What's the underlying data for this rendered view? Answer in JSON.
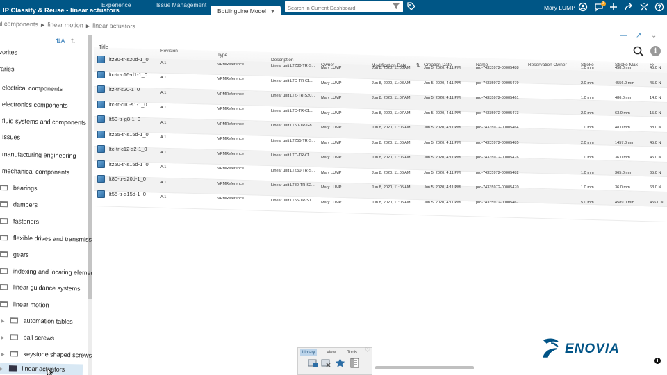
{
  "header": {
    "app_title": "IP Classify & Reuse - linear actuators",
    "tabs": [
      {
        "label": "Experience"
      },
      {
        "label": "Issue Management"
      },
      {
        "label": "BottlingLine Model"
      }
    ],
    "add_tab_label": "+",
    "search_placeholder": "Search in Current Dashboard",
    "user_name": "Mary LUMP",
    "notification_count": "3"
  },
  "breadcrumb": [
    "mechanical components",
    "linear motion",
    "linear actuators"
  ],
  "sidebar": {
    "items": [
      {
        "label": "Favorites"
      },
      {
        "label": "Libraries"
      },
      {
        "label": "electrical components"
      },
      {
        "label": "electronics components"
      },
      {
        "label": "fluid systems and components"
      },
      {
        "label": "Issues"
      },
      {
        "label": "manufacturing engineering"
      },
      {
        "label": "mechanical components"
      },
      {
        "label": "bearings"
      },
      {
        "label": "dampers"
      },
      {
        "label": "fasteners"
      },
      {
        "label": "flexible drives and transmissions"
      },
      {
        "label": "gears"
      },
      {
        "label": "indexing and locating elements"
      },
      {
        "label": "linear guidance systems"
      },
      {
        "label": "linear motion"
      },
      {
        "label": "automation tables"
      },
      {
        "label": "ball screws"
      },
      {
        "label": "keystone shaped screws"
      },
      {
        "label": "linear actuators"
      }
    ]
  },
  "table": {
    "columns": [
      "Title",
      "Revision",
      "Type",
      "Description",
      "Owner",
      "Modification Date",
      "Creation Date",
      "Name",
      "Reservation Owner",
      "Stroke",
      "Stroke Max",
      "Fx"
    ],
    "rows": [
      {
        "title": "ltz80-tr-s20d-1_0",
        "revision": "A.1",
        "type": "VPMReference",
        "description": "Linear unit LTZ80-TR-S...",
        "owner": "Mary LUMP",
        "modified": "Jun 8, 2020, 11:08 AM",
        "created": "Jun 5, 2020, 4:11 PM",
        "name": "prd-74335972-00005488",
        "reservation": "",
        "stroke": "1.0 mm",
        "stroke_max": "458.0 mm",
        "fx": "45.0 N"
      },
      {
        "title": "ltc-tr-c16-d1-1_0",
        "revision": "A.1",
        "type": "VPMReference",
        "description": "Linear unit LTC-TR-C1...",
        "owner": "Mary LUMP",
        "modified": "Jun 8, 2020, 11:08 AM",
        "created": "Jun 5, 2020, 4:11 PM",
        "name": "prd-74335972-00005479",
        "reservation": "",
        "stroke": "2.0 mm",
        "stroke_max": "4556.0 mm",
        "fx": "45.0 N"
      },
      {
        "title": "ltz-tr-s20-1_0",
        "revision": "A.1",
        "type": "VPMReference",
        "description": "Linear unit LTZ-TR-S20...",
        "owner": "Mary LUMP",
        "modified": "Jun 8, 2020, 11:07 AM",
        "created": "Jun 5, 2020, 4:11 PM",
        "name": "prd-74335972-00005461",
        "reservation": "",
        "stroke": "1.0 mm",
        "stroke_max": "486.0 mm",
        "fx": "14.0 N"
      },
      {
        "title": "ltc-tr-c10-s1-1_0",
        "revision": "A.1",
        "type": "VPMReference",
        "description": "Linear unit LTC-TR-C1...",
        "owner": "Mary LUMP",
        "modified": "Jun 8, 2020, 11:07 AM",
        "created": "Jun 5, 2020, 4:11 PM",
        "name": "prd-74335972-00005473",
        "reservation": "",
        "stroke": "2.0 mm",
        "stroke_max": "63.0 mm",
        "fx": "15.0 N"
      },
      {
        "title": "lt50-tr-g8-1_0",
        "revision": "A.1",
        "type": "VPMReference",
        "description": "Linear unit LT50-TR-G8...",
        "owner": "Mary LUMP",
        "modified": "Jun 8, 2020, 11:06 AM",
        "created": "Jun 5, 2020, 4:11 PM",
        "name": "prd-74335972-00005464",
        "reservation": "",
        "stroke": "1.0 mm",
        "stroke_max": "48.0 mm",
        "fx": "88.0 N"
      },
      {
        "title": "ltz55-tr-s15d-1_0",
        "revision": "A.1",
        "type": "VPMReference",
        "description": "Linear unit LTZ55-TR-S...",
        "owner": "Mary LUMP",
        "modified": "Jun 8, 2020, 11:06 AM",
        "created": "Jun 5, 2020, 4:11 PM",
        "name": "prd-74335972-00005485",
        "reservation": "",
        "stroke": "2.0 mm",
        "stroke_max": "1457.0 mm",
        "fx": "45.0 N"
      },
      {
        "title": "ltc-tr-c12-s2-1_0",
        "revision": "A.1",
        "type": "VPMReference",
        "description": "Linear unit LTC-TR-C1...",
        "owner": "Mary LUMP",
        "modified": "Jun 8, 2020, 11:06 AM",
        "created": "Jun 5, 2020, 4:11 PM",
        "name": "prd-74335972-00005476",
        "reservation": "",
        "stroke": "1.0 mm",
        "stroke_max": "36.0 mm",
        "fx": "45.0 N"
      },
      {
        "title": "ltz50-tr-s15d-1_0",
        "revision": "A.1",
        "type": "VPMReference",
        "description": "Linear unit LTZ50-TR-S...",
        "owner": "Mary LUMP",
        "modified": "Jun 8, 2020, 11:06 AM",
        "created": "Jun 5, 2020, 4:11 PM",
        "name": "prd-74335972-00005482",
        "reservation": "",
        "stroke": "1.0 mm",
        "stroke_max": "365.0 mm",
        "fx": "65.0 N"
      },
      {
        "title": "lt80-tr-s20d-1_0",
        "revision": "A.1",
        "type": "VPMReference",
        "description": "Linear unit LT80-TR-S2...",
        "owner": "Mary LUMP",
        "modified": "Jun 8, 2020, 11:05 AM",
        "created": "Jun 5, 2020, 4:11 PM",
        "name": "prd-74335972-00005470",
        "reservation": "",
        "stroke": "1.0 mm",
        "stroke_max": "36.0 mm",
        "fx": "63.0 N"
      },
      {
        "title": "lt55-tr-s15d-1_0",
        "revision": "A.1",
        "type": "VPMReference",
        "description": "Linear unit LT55-TR-S1...",
        "owner": "Mary LUMP",
        "modified": "Jun 8, 2020, 11:05 AM",
        "created": "Jun 5, 2020, 4:11 PM",
        "name": "prd-74335972-00005467",
        "reservation": "",
        "stroke": "5.0 mm",
        "stroke_max": "4589.0 mm",
        "fx": "456.0 N"
      }
    ]
  },
  "bottom_toolbar": {
    "tabs": [
      {
        "label": "Library"
      },
      {
        "label": "View"
      },
      {
        "label": "Tools"
      }
    ]
  },
  "brand": {
    "name": "ENOVIA",
    "color": "#005386"
  },
  "colors": {
    "topbar": "#005686",
    "accent": "#1f6fb2",
    "selected_row": "#d8e8f4"
  },
  "icons": [
    "search-icon",
    "funnel-icon",
    "tag-icon",
    "user-icon",
    "chat-icon",
    "plus-icon",
    "share-icon",
    "tools-icon",
    "help-icon",
    "info-icon",
    "product-cube-icon",
    "folder-icon"
  ]
}
